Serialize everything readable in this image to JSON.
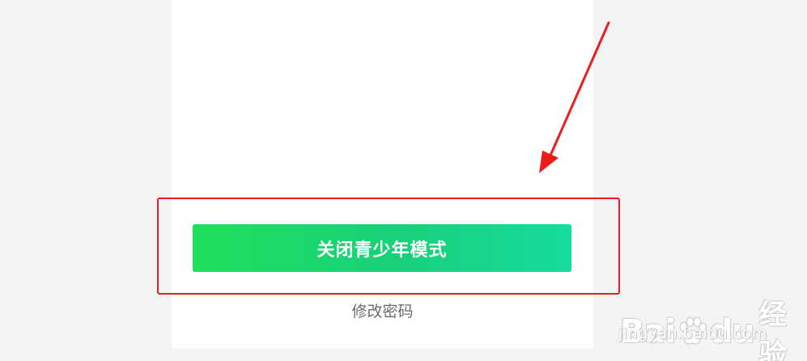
{
  "youth_mode": {
    "close_button_label": "关闭青少年模式",
    "change_password_link": "修改密码"
  },
  "annotation": {
    "highlight_color": "#ee1d1d"
  },
  "watermark": {
    "brand_left": "Bai",
    "brand_right": "du",
    "brand_cn": "经验",
    "url": "jingyan.baidu.com"
  },
  "colors": {
    "button_gradient_start": "#1ee05c",
    "button_gradient_end": "#17dc9e",
    "page_background": "#f4f4f4",
    "panel_background": "#ffffff"
  }
}
